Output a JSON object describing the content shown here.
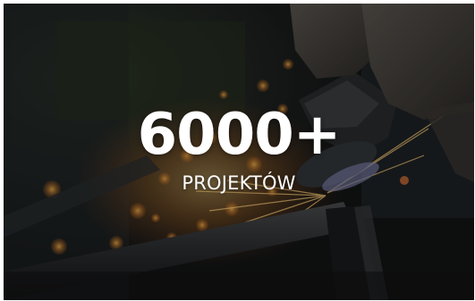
{
  "stat": {
    "value": "6000+",
    "label": "PROJEKTÓW"
  }
}
